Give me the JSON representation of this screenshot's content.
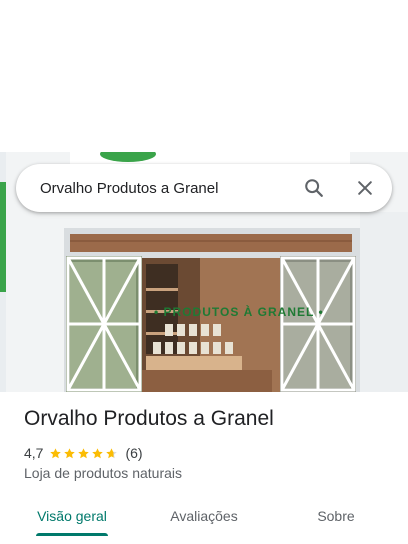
{
  "search": {
    "query": "Orvalho Produtos a Granel",
    "search_icon": "search-icon",
    "close_icon": "close-icon"
  },
  "photo": {
    "sign_text": "• PRODUTOS À GRANEL •"
  },
  "place": {
    "name": "Orvalho Produtos a Granel",
    "rating": "4,7",
    "rating_value": 4.7,
    "review_count": "(6)",
    "category": "Loja de produtos naturais"
  },
  "tabs": [
    {
      "label": "Visão geral",
      "active": true
    },
    {
      "label": "Avaliações",
      "active": false
    },
    {
      "label": "Sobre",
      "active": false
    }
  ],
  "colors": {
    "accent": "#00796b",
    "star": "#fbbc04",
    "star_empty": "#dadce0"
  }
}
